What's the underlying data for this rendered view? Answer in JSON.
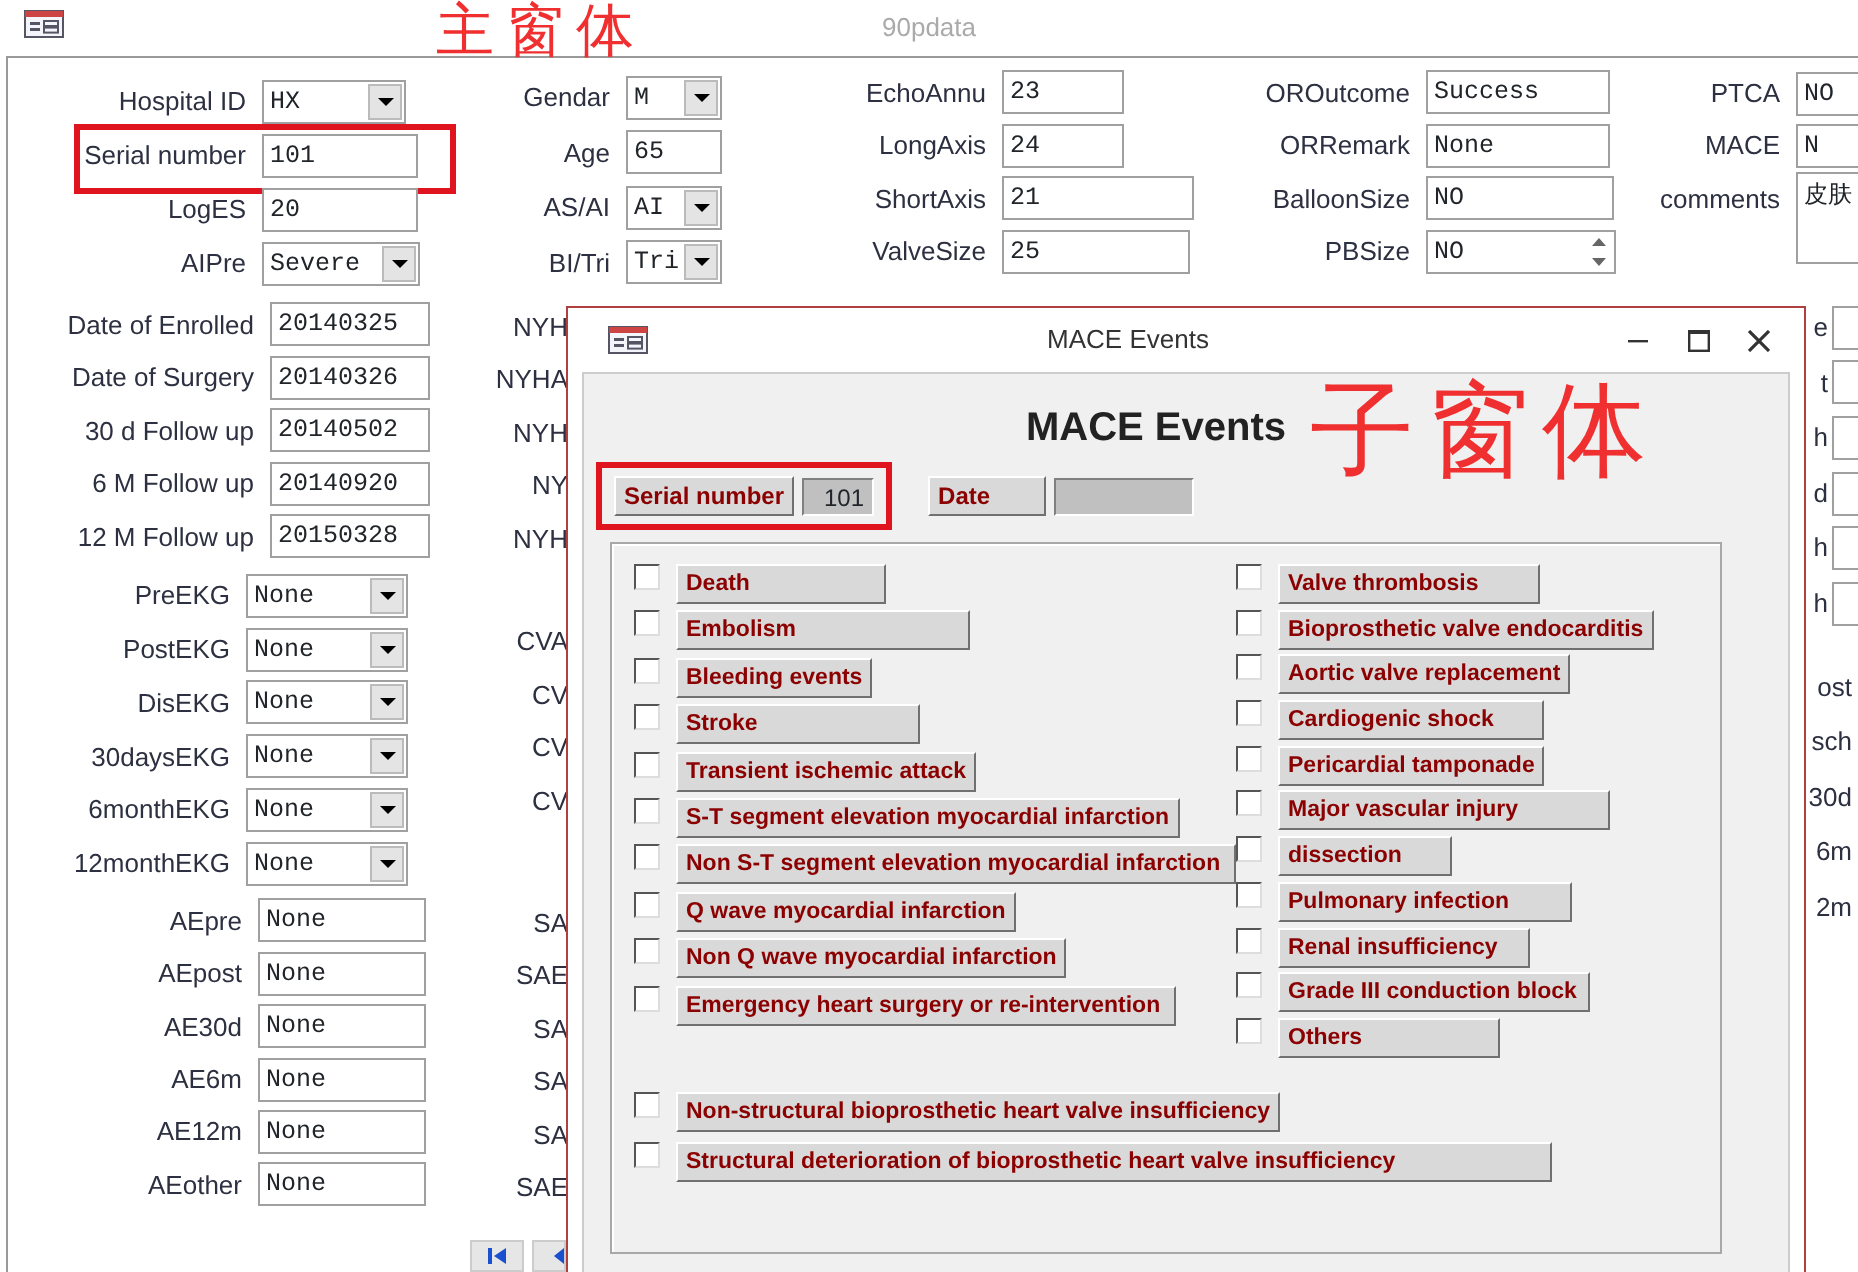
{
  "window": {
    "title": "90pdata"
  },
  "main_form": {
    "annotation": "主窗体",
    "columns": [
      {
        "sections": [
          [
            {
              "label": "Hospital ID",
              "kind": "combo",
              "value": "HX"
            },
            {
              "label": "Serial number",
              "kind": "text",
              "value": "101",
              "highlighted": true
            },
            {
              "label": "LogES",
              "kind": "text",
              "value": "20"
            },
            {
              "label": "AIPre",
              "kind": "combo",
              "value": "Severe"
            }
          ],
          [
            {
              "label": "Date of Enrolled",
              "kind": "text",
              "value": "20140325"
            },
            {
              "label": "Date of Surgery",
              "kind": "text",
              "value": "20140326"
            },
            {
              "label": "30 d Follow up",
              "kind": "text",
              "value": "20140502"
            },
            {
              "label": "6 M Follow up",
              "kind": "text",
              "value": "20140920"
            },
            {
              "label": "12 M Follow up",
              "kind": "text",
              "value": "20150328"
            }
          ],
          [
            {
              "label": "PreEKG",
              "kind": "combo",
              "value": "None"
            },
            {
              "label": "PostEKG",
              "kind": "combo",
              "value": "None"
            },
            {
              "label": "DisEKG",
              "kind": "combo",
              "value": "None"
            },
            {
              "label": "30daysEKG",
              "kind": "combo",
              "value": "None"
            },
            {
              "label": "6monthEKG",
              "kind": "combo",
              "value": "None"
            },
            {
              "label": "12monthEKG",
              "kind": "combo",
              "value": "None"
            }
          ],
          [
            {
              "label": "AEpre",
              "kind": "text",
              "value": "None"
            },
            {
              "label": "AEpost",
              "kind": "text",
              "value": "None"
            },
            {
              "label": "AE30d",
              "kind": "text",
              "value": "None"
            },
            {
              "label": "AE6m",
              "kind": "text",
              "value": "None"
            },
            {
              "label": "AE12m",
              "kind": "text",
              "value": "None"
            },
            {
              "label": "AEother",
              "kind": "text",
              "value": "None"
            }
          ]
        ]
      },
      {
        "sections": [
          [
            {
              "label": "Gendar",
              "kind": "combo",
              "value": "M"
            },
            {
              "label": "Age",
              "kind": "text",
              "value": "65"
            },
            {
              "label": "AS/AI",
              "kind": "combo",
              "value": "AI"
            },
            {
              "label": "BI/Tri",
              "kind": "combo",
              "value": "Tri"
            }
          ],
          [
            {
              "label": "NYH",
              "kind": "label"
            },
            {
              "label": "NYHA",
              "kind": "label"
            },
            {
              "label": "NYH",
              "kind": "label"
            },
            {
              "label": "NY",
              "kind": "label"
            },
            {
              "label": "NYH",
              "kind": "label"
            }
          ],
          [
            {
              "label": "CVA",
              "kind": "label"
            },
            {
              "label": "CV",
              "kind": "label"
            },
            {
              "label": "CV",
              "kind": "label"
            },
            {
              "label": "CV",
              "kind": "label"
            }
          ],
          [
            {
              "label": "SA",
              "kind": "label"
            },
            {
              "label": "SAE",
              "kind": "label"
            },
            {
              "label": "SA",
              "kind": "label"
            },
            {
              "label": "SA",
              "kind": "label"
            },
            {
              "label": "SA",
              "kind": "label"
            },
            {
              "label": "SAE",
              "kind": "label"
            }
          ]
        ]
      },
      {
        "sections": [
          [
            {
              "label": "EchoAnnu",
              "kind": "text",
              "value": "23"
            },
            {
              "label": "LongAxis",
              "kind": "text",
              "value": "24"
            },
            {
              "label": "ShortAxis",
              "kind": "text",
              "value": "21"
            },
            {
              "label": "ValveSize",
              "kind": "text",
              "value": "25"
            }
          ]
        ]
      },
      {
        "sections": [
          [
            {
              "label": "OROutcome",
              "kind": "text",
              "value": "Success"
            },
            {
              "label": "ORRemark",
              "kind": "text",
              "value": "None"
            },
            {
              "label": "BalloonSize",
              "kind": "text",
              "value": "NO"
            },
            {
              "label": "PBSize",
              "kind": "spin",
              "value": "NO"
            }
          ]
        ]
      },
      {
        "sections": [
          [
            {
              "label": "PTCA",
              "kind": "text",
              "value": "NO"
            },
            {
              "label": "MACE",
              "kind": "text",
              "value": "N"
            },
            {
              "label": "comments",
              "kind": "memo",
              "value": "皮肤"
            }
          ]
        ]
      },
      {
        "sections": [
          [
            {
              "label": "e",
              "kind": "text"
            },
            {
              "label": "t",
              "kind": "text"
            },
            {
              "label": "h",
              "kind": "text"
            },
            {
              "label": "d",
              "kind": "text"
            },
            {
              "label": "h",
              "kind": "text"
            },
            {
              "label": "h",
              "kind": "text"
            }
          ],
          [
            {
              "label": "ost",
              "kind": "label"
            },
            {
              "label": "sch",
              "kind": "label"
            },
            {
              "label": "30d",
              "kind": "label"
            },
            {
              "label": "6m",
              "kind": "label"
            },
            {
              "label": "2m",
              "kind": "label"
            }
          ]
        ]
      }
    ]
  },
  "mace_window": {
    "title": "MACE Events",
    "heading": "MACE Events",
    "annotation": "子窗体",
    "serial": {
      "label": "Serial number",
      "value": "101",
      "highlighted": true
    },
    "date": {
      "label": "Date"
    },
    "columns": [
      [
        {
          "label": "Death",
          "checked": false
        },
        {
          "label": "Embolism",
          "checked": false
        },
        {
          "label": "Bleeding events",
          "checked": false
        },
        {
          "label": "Stroke",
          "checked": false
        },
        {
          "label": "Transient ischemic attack",
          "checked": false
        },
        {
          "label": "S-T segment elevation myocardial infarction",
          "checked": false
        },
        {
          "label": "Non S-T segment elevation myocardial infarction",
          "checked": false
        },
        {
          "label": "Q wave myocardial infarction",
          "checked": false
        },
        {
          "label": "Non Q wave myocardial infarction",
          "checked": false
        },
        {
          "label": "Emergency heart surgery or re-intervention",
          "checked": false
        }
      ],
      [
        {
          "label": "Valve thrombosis",
          "checked": false
        },
        {
          "label": "Bioprosthetic valve endocarditis",
          "checked": false
        },
        {
          "label": "Aortic valve replacement",
          "checked": false
        },
        {
          "label": "Cardiogenic shock",
          "checked": false
        },
        {
          "label": "Pericardial tamponade",
          "checked": false
        },
        {
          "label": "Major vascular injury",
          "checked": false
        },
        {
          "label": "dissection",
          "checked": false
        },
        {
          "label": "Pulmonary infection",
          "checked": false
        },
        {
          "label": "Renal insufficiency",
          "checked": false
        },
        {
          "label": "Grade III conduction block",
          "checked": false
        },
        {
          "label": "Others",
          "checked": false
        }
      ]
    ],
    "bottom_items": [
      {
        "label": "Non-structural bioprosthetic heart valve insufficiency",
        "checked": false
      },
      {
        "label": "Structural deterioration of bioprosthetic heart valve insufficiency",
        "checked": false
      }
    ]
  }
}
